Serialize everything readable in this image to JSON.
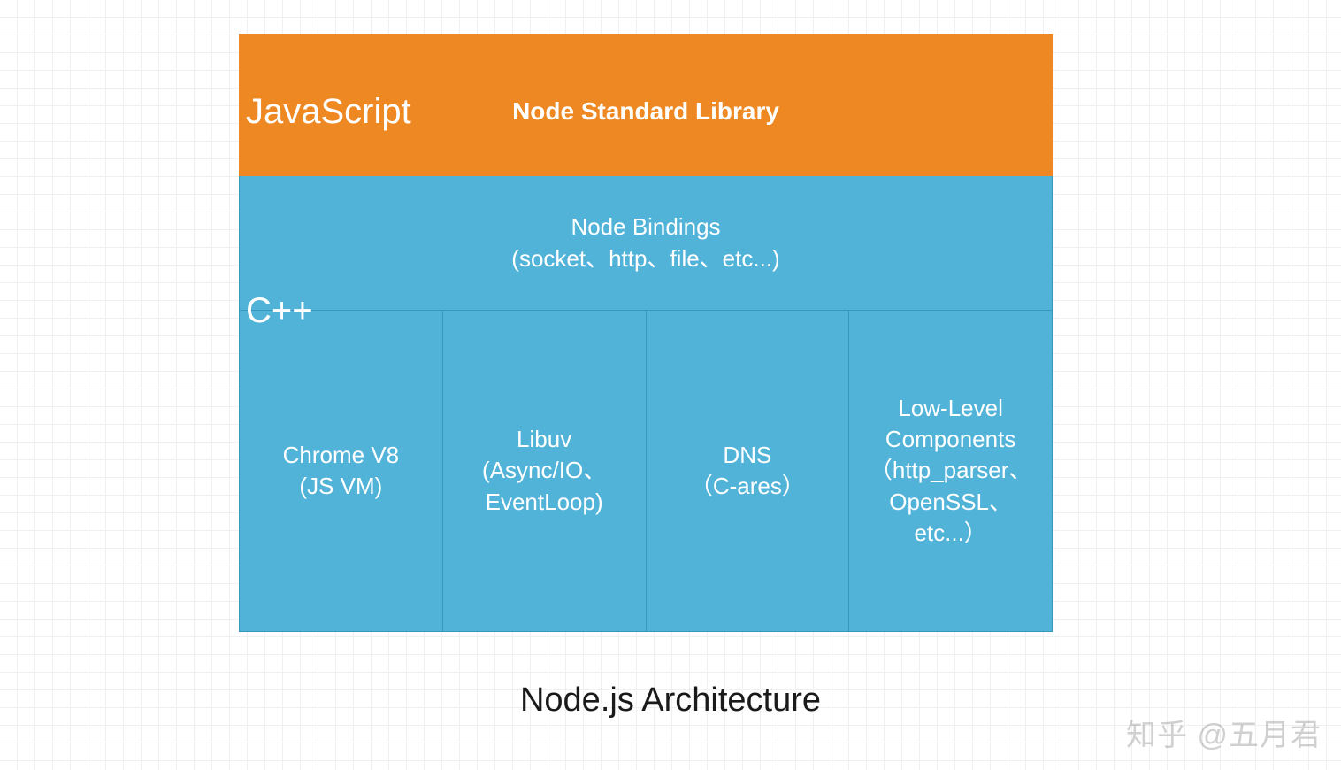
{
  "colors": {
    "orange": "#ee8822",
    "blue": "#52b3d9",
    "blue_border": "#3a97bc",
    "text_white": "#ffffff"
  },
  "layers": {
    "js": {
      "language_label": "JavaScript",
      "title": "Node Standard Library"
    },
    "cpp": {
      "language_label": "C++",
      "bindings": {
        "line1": "Node Bindings",
        "line2": "(socket、http、file、etc...)"
      },
      "components": [
        {
          "line1": "Chrome V8",
          "line2": "(JS VM)"
        },
        {
          "line1": "Libuv",
          "line2": "(Async/IO、",
          "line3": "EventLoop)"
        },
        {
          "line1": "DNS",
          "line2": "（C-ares）"
        },
        {
          "line1": "Low-Level",
          "line2": "Components",
          "line3": "（http_parser、",
          "line4": "OpenSSL、",
          "line5": "etc...）"
        }
      ]
    }
  },
  "caption": "Node.js Architecture",
  "watermark": "知乎 @五月君"
}
